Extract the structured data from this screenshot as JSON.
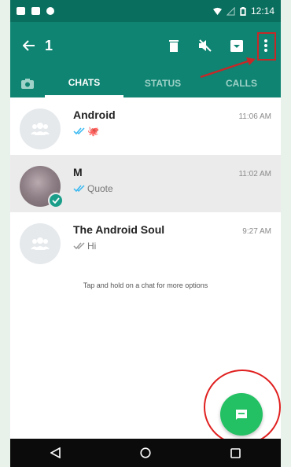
{
  "status_bar": {
    "time": "12:14"
  },
  "action_bar": {
    "selected_count": "1"
  },
  "tabs": [
    {
      "label": "CHATS",
      "active": true
    },
    {
      "label": "STATUS",
      "active": false
    },
    {
      "label": "CALLS",
      "active": false
    }
  ],
  "chats": [
    {
      "name": "Android",
      "time": "11:06 AM",
      "preview": "",
      "emoji": "🐙",
      "selected": false
    },
    {
      "name": "M",
      "time": "11:02 AM",
      "preview": "Quote",
      "emoji": "",
      "selected": true
    },
    {
      "name": "The Android Soul",
      "time": "9:27 AM",
      "preview": "Hi",
      "emoji": "",
      "selected": false
    }
  ],
  "hint": "Tap and hold on a chat for more options",
  "colors": {
    "status_bar": "#0a6e5e",
    "toolbar": "#0f8472",
    "fab": "#24c164",
    "annotation": "#c62828",
    "read_ticks": "#34b7f1"
  },
  "icons": {
    "back": "arrow-left-icon",
    "delete": "trash-icon",
    "mute": "mute-icon",
    "archive": "archive-icon",
    "more": "more-vert-icon",
    "camera": "camera-icon",
    "fab": "new-chat-icon"
  }
}
